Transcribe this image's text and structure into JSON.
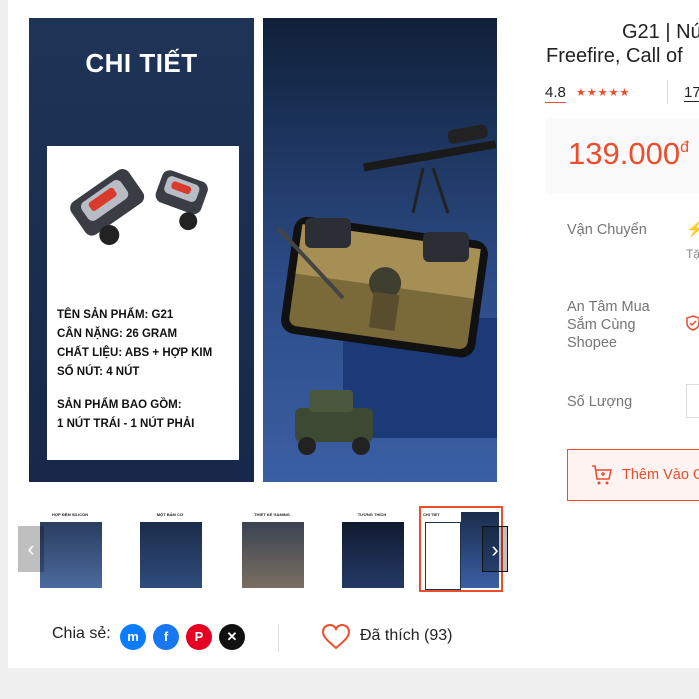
{
  "product": {
    "title_line1": "G21 | Nú",
    "title_line2": "Freefire, Call of"
  },
  "gallery": {
    "heading": "CHI TIẾT",
    "spec_lines": [
      "TÊN SẢN PHẨM: G21",
      "CÂN NẶNG: 26 GRAM",
      "CHẤT LIỆU: ABS + HỢP KIM",
      "SỐ NÚT: 4 NÚT"
    ],
    "package_lines": [
      "SẢN PHẨM BAO GỒM:",
      "1 NÚT TRÁI - 1 NÚT PHẢI"
    ],
    "thumbnails": [
      {
        "caption": "HỢP ĐỆM SILICON"
      },
      {
        "caption": "MỘT BẤM CƠ"
      },
      {
        "caption": "THIẾT KẾ GAMING"
      },
      {
        "caption": "TƯƠNG THÍCH"
      },
      {
        "caption": "CHI TIẾT"
      }
    ],
    "prev_icon": "chevron-left-icon",
    "next_icon": "chevron-right-icon"
  },
  "share": {
    "label": "Chia sẻ:",
    "icons": [
      "messenger-icon",
      "facebook-icon",
      "pinterest-icon",
      "x-icon"
    ]
  },
  "like": {
    "label": "Đã thích (93)"
  },
  "rating": {
    "score": "4.8",
    "stars": "★★★★★",
    "count": "17"
  },
  "price": {
    "value": "139.000",
    "currency": "đ"
  },
  "details": {
    "shipping_label": "Vận Chuyển",
    "shipping_sub": "Tặ",
    "guarantee_label": "An Tâm Mua Sắm Cùng Shopee",
    "quantity_label": "Số Lượng"
  },
  "actions": {
    "add_to_cart": "Thêm Vào G"
  },
  "colors": {
    "accent": "#ee4d2d",
    "shipping": "#00bfa5",
    "messenger": "#0a7cff",
    "facebook": "#1877f2",
    "pinterest": "#e60023",
    "x": "#111111"
  }
}
